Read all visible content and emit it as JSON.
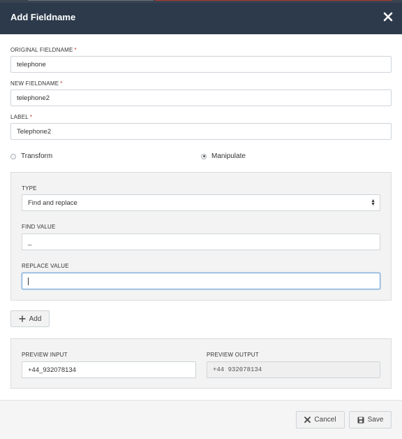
{
  "modal": {
    "title": "Add Fieldname",
    "close_icon": "close-icon"
  },
  "form": {
    "original_fieldname": {
      "label": "ORIGINAL FIELDNAME",
      "required_mark": "*",
      "value": "telephone"
    },
    "new_fieldname": {
      "label": "NEW FIELDNAME",
      "required_mark": "*",
      "value": "telephone2"
    },
    "label_field": {
      "label": "LABEL",
      "required_mark": "*",
      "value": "Telephone2"
    },
    "mode_options": [
      {
        "label": "Transform",
        "selected": false
      },
      {
        "label": "Manipulate",
        "selected": true
      }
    ]
  },
  "manipulate": {
    "type_label": "TYPE",
    "type_value": "Find and replace",
    "find_label": "FIND VALUE",
    "find_value": "_",
    "replace_label": "REPLACE VALUE",
    "replace_value": ""
  },
  "add_button": {
    "label": "Add",
    "icon": "plus-icon"
  },
  "preview": {
    "input_label": "PREVIEW INPUT",
    "input_value": "+44_932078134",
    "output_label": "PREVIEW OUTPUT",
    "output_value": "+44 932078134"
  },
  "footer": {
    "cancel_label": "Cancel",
    "cancel_icon": "times-icon",
    "save_label": "Save",
    "save_icon": "floppy-disk-icon"
  },
  "colors": {
    "header_bg": "#2c3a4b",
    "required": "#c0392b",
    "focus_border": "#6fa3d6"
  }
}
